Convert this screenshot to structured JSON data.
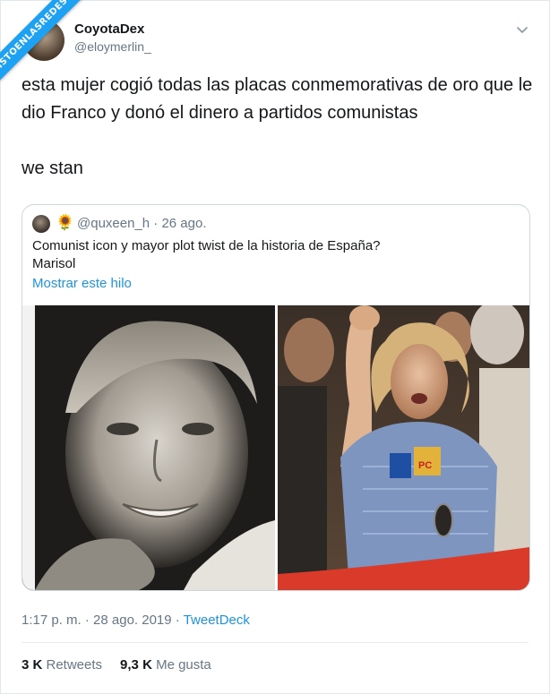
{
  "banner": {
    "text": "VISTOENLASREDES.COM"
  },
  "author": {
    "name": "CoyotaDex",
    "handle": "@eloymerlin_"
  },
  "tweet": {
    "line1": "esta mujer cogió todas las placas conmemorativas de oro que le dio Franco y donó el dinero a partidos comunistas",
    "line2": "we stan"
  },
  "quote": {
    "handle_date": "@quxeen_h · 26 ago.",
    "emoji": "🌻",
    "text_line1": "Comunist icon y mayor plot twist de la historia de España?",
    "text_line2": "Marisol",
    "thread_link": "Mostrar este hilo",
    "images": [
      {
        "name": "photo-child",
        "description": ""
      },
      {
        "name": "photo-protest",
        "badge": "PC"
      }
    ]
  },
  "meta": {
    "timestamp": "1:17 p. m. · 28 ago. 2019 · ",
    "app": "TweetDeck"
  },
  "stats": {
    "retweets_count": "3 K",
    "retweets_label": " Retweets",
    "likes_count": "9,3 K",
    "likes_label": " Me gusta"
  },
  "colors": {
    "accent": "#1da1f2",
    "link": "#1b95e0",
    "muted": "#657786"
  }
}
